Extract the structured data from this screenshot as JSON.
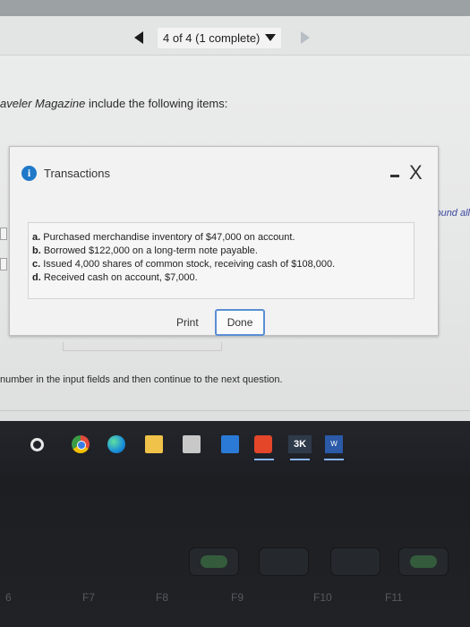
{
  "navigation": {
    "counter_text": "4 of 4 (1 complete)"
  },
  "question": {
    "intro_partial": "aveler Magazine",
    "intro_rest": " include the following items:",
    "footer_partial": "number in the input fields and then continue to the next question.",
    "side_edge_text": "ound all"
  },
  "modal": {
    "title": "Transactions",
    "minimize_glyph": "-",
    "close_glyph": "X",
    "items": [
      {
        "letter": "a.",
        "text": " Purchased merchandise inventory of $47,000 on account."
      },
      {
        "letter": "b.",
        "text": " Borrowed $122,000 on a long-term note payable."
      },
      {
        "letter": "c.",
        "text": " Issued 4,000 shares of common stock, receiving cash of $108,000."
      },
      {
        "letter": "d.",
        "text": " Received cash on account, $7,000."
      }
    ],
    "print_label": "Print",
    "done_label": "Done"
  },
  "taskbar": {
    "apps": [
      "search-icon",
      "chrome-icon",
      "edge-icon",
      "file-explorer-icon",
      "store-icon",
      "mail-icon",
      "office-icon",
      "3k-app-icon",
      "word-icon"
    ],
    "app_3k_label": "3K",
    "word_label": "W"
  },
  "keyboard": {
    "fkeys": [
      "6",
      "F7",
      "F8",
      "F9",
      "F10",
      "F11"
    ]
  },
  "colors": {
    "accent_blue": "#1f78c8",
    "done_border": "#5b8ed3",
    "taskbar_bg": "#23252b"
  }
}
